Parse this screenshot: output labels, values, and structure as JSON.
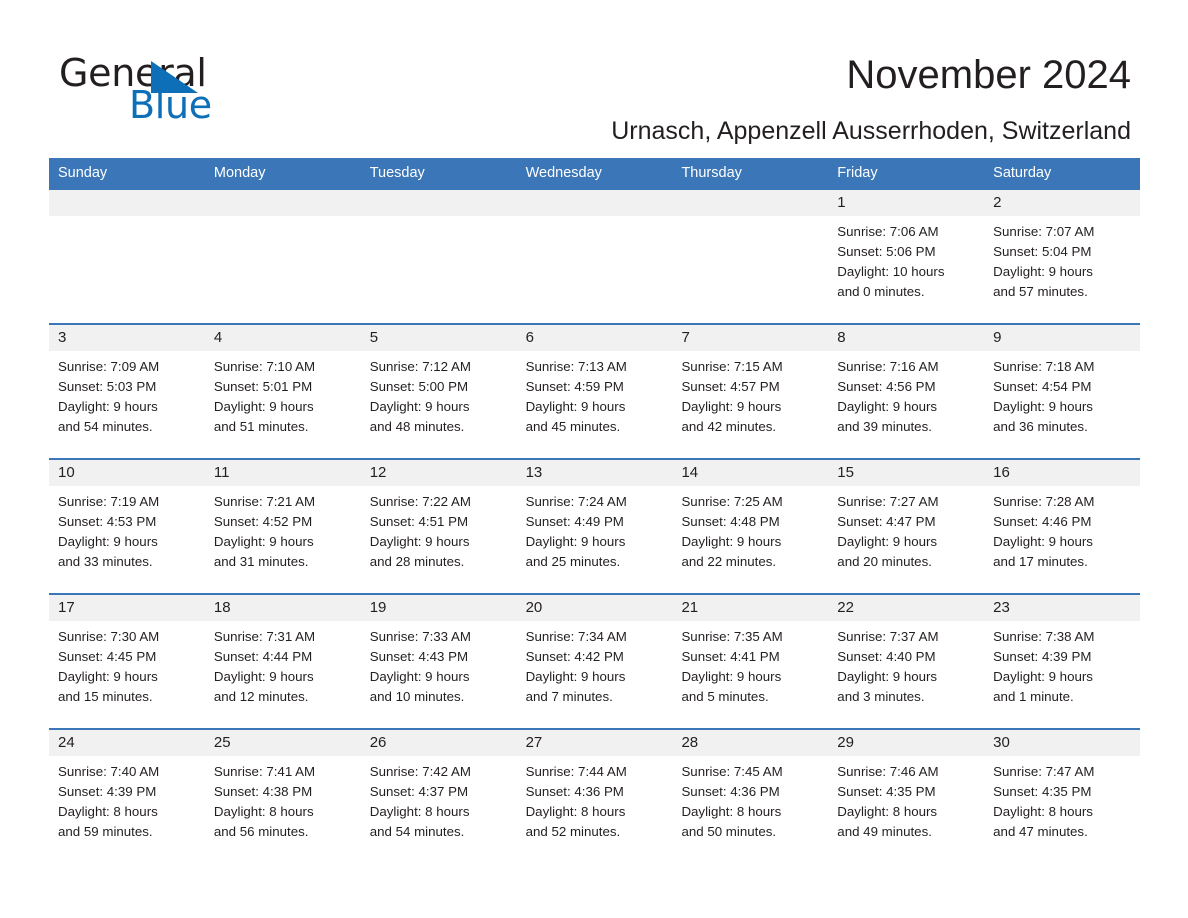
{
  "brand": {
    "name_part1": "General",
    "name_part2": "Blue",
    "flag_icon": "triangle-flag-icon",
    "accent_color": "#0c6fb8"
  },
  "header": {
    "title": "November 2024",
    "subtitle": "Urnasch, Appenzell Ausserrhoden, Switzerland"
  },
  "theme": {
    "header_blue": "#3a76b8",
    "daynum_band": "#f1f1f1",
    "text": "#231f20"
  },
  "calendar": {
    "weekday_headers": [
      "Sunday",
      "Monday",
      "Tuesday",
      "Wednesday",
      "Thursday",
      "Friday",
      "Saturday"
    ],
    "weeks": [
      [
        {
          "day": "",
          "sunrise": "",
          "sunset": "",
          "daylight_line1": "",
          "daylight_line2": "",
          "empty": true
        },
        {
          "day": "",
          "sunrise": "",
          "sunset": "",
          "daylight_line1": "",
          "daylight_line2": "",
          "empty": true
        },
        {
          "day": "",
          "sunrise": "",
          "sunset": "",
          "daylight_line1": "",
          "daylight_line2": "",
          "empty": true
        },
        {
          "day": "",
          "sunrise": "",
          "sunset": "",
          "daylight_line1": "",
          "daylight_line2": "",
          "empty": true
        },
        {
          "day": "",
          "sunrise": "",
          "sunset": "",
          "daylight_line1": "",
          "daylight_line2": "",
          "empty": true
        },
        {
          "day": "1",
          "sunrise": "Sunrise: 7:06 AM",
          "sunset": "Sunset: 5:06 PM",
          "daylight_line1": "Daylight: 10 hours",
          "daylight_line2": "and 0 minutes.",
          "empty": false
        },
        {
          "day": "2",
          "sunrise": "Sunrise: 7:07 AM",
          "sunset": "Sunset: 5:04 PM",
          "daylight_line1": "Daylight: 9 hours",
          "daylight_line2": "and 57 minutes.",
          "empty": false
        }
      ],
      [
        {
          "day": "3",
          "sunrise": "Sunrise: 7:09 AM",
          "sunset": "Sunset: 5:03 PM",
          "daylight_line1": "Daylight: 9 hours",
          "daylight_line2": "and 54 minutes.",
          "empty": false
        },
        {
          "day": "4",
          "sunrise": "Sunrise: 7:10 AM",
          "sunset": "Sunset: 5:01 PM",
          "daylight_line1": "Daylight: 9 hours",
          "daylight_line2": "and 51 minutes.",
          "empty": false
        },
        {
          "day": "5",
          "sunrise": "Sunrise: 7:12 AM",
          "sunset": "Sunset: 5:00 PM",
          "daylight_line1": "Daylight: 9 hours",
          "daylight_line2": "and 48 minutes.",
          "empty": false
        },
        {
          "day": "6",
          "sunrise": "Sunrise: 7:13 AM",
          "sunset": "Sunset: 4:59 PM",
          "daylight_line1": "Daylight: 9 hours",
          "daylight_line2": "and 45 minutes.",
          "empty": false
        },
        {
          "day": "7",
          "sunrise": "Sunrise: 7:15 AM",
          "sunset": "Sunset: 4:57 PM",
          "daylight_line1": "Daylight: 9 hours",
          "daylight_line2": "and 42 minutes.",
          "empty": false
        },
        {
          "day": "8",
          "sunrise": "Sunrise: 7:16 AM",
          "sunset": "Sunset: 4:56 PM",
          "daylight_line1": "Daylight: 9 hours",
          "daylight_line2": "and 39 minutes.",
          "empty": false
        },
        {
          "day": "9",
          "sunrise": "Sunrise: 7:18 AM",
          "sunset": "Sunset: 4:54 PM",
          "daylight_line1": "Daylight: 9 hours",
          "daylight_line2": "and 36 minutes.",
          "empty": false
        }
      ],
      [
        {
          "day": "10",
          "sunrise": "Sunrise: 7:19 AM",
          "sunset": "Sunset: 4:53 PM",
          "daylight_line1": "Daylight: 9 hours",
          "daylight_line2": "and 33 minutes.",
          "empty": false
        },
        {
          "day": "11",
          "sunrise": "Sunrise: 7:21 AM",
          "sunset": "Sunset: 4:52 PM",
          "daylight_line1": "Daylight: 9 hours",
          "daylight_line2": "and 31 minutes.",
          "empty": false
        },
        {
          "day": "12",
          "sunrise": "Sunrise: 7:22 AM",
          "sunset": "Sunset: 4:51 PM",
          "daylight_line1": "Daylight: 9 hours",
          "daylight_line2": "and 28 minutes.",
          "empty": false
        },
        {
          "day": "13",
          "sunrise": "Sunrise: 7:24 AM",
          "sunset": "Sunset: 4:49 PM",
          "daylight_line1": "Daylight: 9 hours",
          "daylight_line2": "and 25 minutes.",
          "empty": false
        },
        {
          "day": "14",
          "sunrise": "Sunrise: 7:25 AM",
          "sunset": "Sunset: 4:48 PM",
          "daylight_line1": "Daylight: 9 hours",
          "daylight_line2": "and 22 minutes.",
          "empty": false
        },
        {
          "day": "15",
          "sunrise": "Sunrise: 7:27 AM",
          "sunset": "Sunset: 4:47 PM",
          "daylight_line1": "Daylight: 9 hours",
          "daylight_line2": "and 20 minutes.",
          "empty": false
        },
        {
          "day": "16",
          "sunrise": "Sunrise: 7:28 AM",
          "sunset": "Sunset: 4:46 PM",
          "daylight_line1": "Daylight: 9 hours",
          "daylight_line2": "and 17 minutes.",
          "empty": false
        }
      ],
      [
        {
          "day": "17",
          "sunrise": "Sunrise: 7:30 AM",
          "sunset": "Sunset: 4:45 PM",
          "daylight_line1": "Daylight: 9 hours",
          "daylight_line2": "and 15 minutes.",
          "empty": false
        },
        {
          "day": "18",
          "sunrise": "Sunrise: 7:31 AM",
          "sunset": "Sunset: 4:44 PM",
          "daylight_line1": "Daylight: 9 hours",
          "daylight_line2": "and 12 minutes.",
          "empty": false
        },
        {
          "day": "19",
          "sunrise": "Sunrise: 7:33 AM",
          "sunset": "Sunset: 4:43 PM",
          "daylight_line1": "Daylight: 9 hours",
          "daylight_line2": "and 10 minutes.",
          "empty": false
        },
        {
          "day": "20",
          "sunrise": "Sunrise: 7:34 AM",
          "sunset": "Sunset: 4:42 PM",
          "daylight_line1": "Daylight: 9 hours",
          "daylight_line2": "and 7 minutes.",
          "empty": false
        },
        {
          "day": "21",
          "sunrise": "Sunrise: 7:35 AM",
          "sunset": "Sunset: 4:41 PM",
          "daylight_line1": "Daylight: 9 hours",
          "daylight_line2": "and 5 minutes.",
          "empty": false
        },
        {
          "day": "22",
          "sunrise": "Sunrise: 7:37 AM",
          "sunset": "Sunset: 4:40 PM",
          "daylight_line1": "Daylight: 9 hours",
          "daylight_line2": "and 3 minutes.",
          "empty": false
        },
        {
          "day": "23",
          "sunrise": "Sunrise: 7:38 AM",
          "sunset": "Sunset: 4:39 PM",
          "daylight_line1": "Daylight: 9 hours",
          "daylight_line2": "and 1 minute.",
          "empty": false
        }
      ],
      [
        {
          "day": "24",
          "sunrise": "Sunrise: 7:40 AM",
          "sunset": "Sunset: 4:39 PM",
          "daylight_line1": "Daylight: 8 hours",
          "daylight_line2": "and 59 minutes.",
          "empty": false
        },
        {
          "day": "25",
          "sunrise": "Sunrise: 7:41 AM",
          "sunset": "Sunset: 4:38 PM",
          "daylight_line1": "Daylight: 8 hours",
          "daylight_line2": "and 56 minutes.",
          "empty": false
        },
        {
          "day": "26",
          "sunrise": "Sunrise: 7:42 AM",
          "sunset": "Sunset: 4:37 PM",
          "daylight_line1": "Daylight: 8 hours",
          "daylight_line2": "and 54 minutes.",
          "empty": false
        },
        {
          "day": "27",
          "sunrise": "Sunrise: 7:44 AM",
          "sunset": "Sunset: 4:36 PM",
          "daylight_line1": "Daylight: 8 hours",
          "daylight_line2": "and 52 minutes.",
          "empty": false
        },
        {
          "day": "28",
          "sunrise": "Sunrise: 7:45 AM",
          "sunset": "Sunset: 4:36 PM",
          "daylight_line1": "Daylight: 8 hours",
          "daylight_line2": "and 50 minutes.",
          "empty": false
        },
        {
          "day": "29",
          "sunrise": "Sunrise: 7:46 AM",
          "sunset": "Sunset: 4:35 PM",
          "daylight_line1": "Daylight: 8 hours",
          "daylight_line2": "and 49 minutes.",
          "empty": false
        },
        {
          "day": "30",
          "sunrise": "Sunrise: 7:47 AM",
          "sunset": "Sunset: 4:35 PM",
          "daylight_line1": "Daylight: 8 hours",
          "daylight_line2": "and 47 minutes.",
          "empty": false
        }
      ]
    ]
  }
}
